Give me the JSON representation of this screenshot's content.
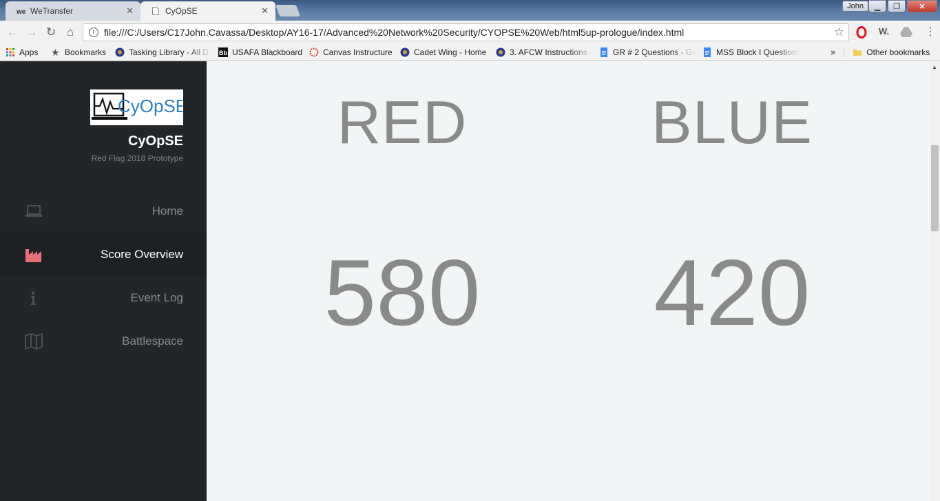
{
  "browser": {
    "tabs": [
      {
        "title": "WeTransfer",
        "favicon": "wetransfer-icon",
        "active": false
      },
      {
        "title": "CyOpSE",
        "favicon": "page-icon",
        "active": true
      }
    ],
    "profile_name": "John",
    "url": "file:///C:/Users/C17John.Cavassa/Desktop/AY16-17/Advanced%20Network%20Security/CYOPSE%20Web/html5up-prologue/index.html",
    "bookmarks": [
      {
        "label": "Apps",
        "icon": "apps-grid-icon"
      },
      {
        "label": "Bookmarks",
        "icon": "star-icon"
      },
      {
        "label": "Tasking Library - All D",
        "icon": "usafa-seal-icon"
      },
      {
        "label": "USAFA Blackboard",
        "icon": "blackboard-icon"
      },
      {
        "label": "Canvas Instructure",
        "icon": "canvas-icon"
      },
      {
        "label": "Cadet Wing - Home",
        "icon": "usafa-seal-icon"
      },
      {
        "label": "3. AFCW Instructions -",
        "icon": "usafa-seal-icon"
      },
      {
        "label": "GR # 2 Questions - Go",
        "icon": "google-doc-icon"
      },
      {
        "label": "MSS Block I Questions",
        "icon": "google-doc-icon"
      }
    ],
    "overflow_label": "»",
    "other_bookmarks": "Other bookmarks",
    "extension_w_label": "W."
  },
  "sidebar": {
    "logo_text": "CyOpSE",
    "site_name": "CyOpSE",
    "site_subtitle": "Red Flag 2018 Prototype",
    "nav": [
      {
        "label": "Home",
        "icon": "laptop-icon",
        "active": false
      },
      {
        "label": "Score Overview",
        "icon": "factory-icon",
        "active": true
      },
      {
        "label": "Event Log",
        "icon": "info-icon",
        "active": false
      },
      {
        "label": "Battlespace",
        "icon": "map-icon",
        "active": false
      }
    ]
  },
  "scores": {
    "red": {
      "team": "RED",
      "score": "580"
    },
    "blue": {
      "team": "BLUE",
      "score": "420"
    }
  },
  "colors": {
    "sidebar_bg": "#222629",
    "active_icon": "#e8707a",
    "score_text": "#8a8a8a"
  }
}
